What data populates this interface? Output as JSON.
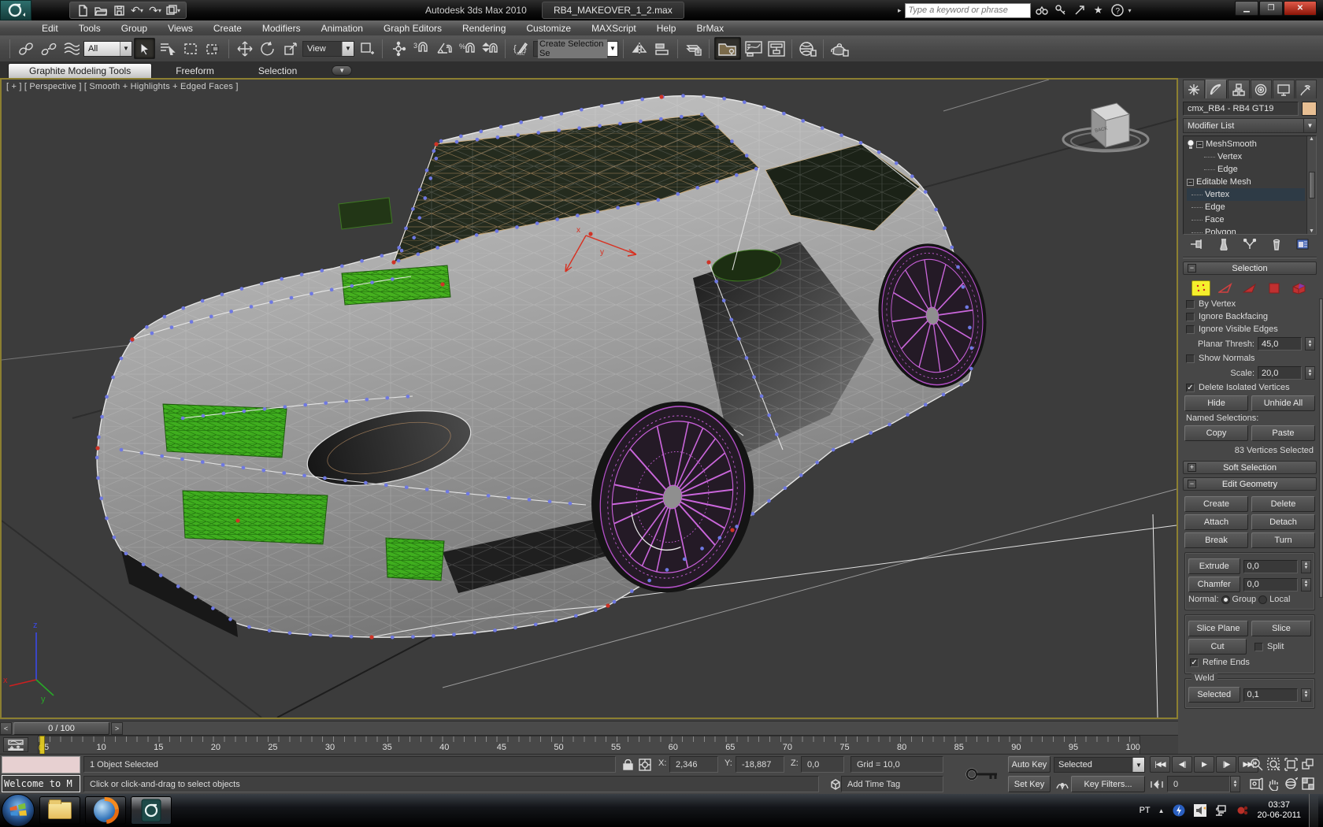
{
  "titlebar": {
    "app_title": "Autodesk 3ds Max 2010",
    "doc_title": "RB4_MAKEOVER_1_2.max",
    "search_placeholder": "Type a keyword or phrase"
  },
  "menubar": {
    "items": [
      "Edit",
      "Tools",
      "Group",
      "Views",
      "Create",
      "Modifiers",
      "Animation",
      "Graph Editors",
      "Rendering",
      "Customize",
      "MAXScript",
      "Help",
      "BrMax"
    ]
  },
  "toolbar": {
    "filter_value": "All",
    "coord_system_value": "View",
    "selection_set_value": "Create Selection Se"
  },
  "ribbon": {
    "tabs": [
      {
        "label": "Graphite Modeling Tools"
      },
      {
        "label": "Freeform"
      },
      {
        "label": "Selection"
      }
    ]
  },
  "viewport": {
    "label": "[ + ] [ Perspective ] [ Smooth + Highlights + Edged Faces ]"
  },
  "command_panel": {
    "object_name": "cmx_RB4 - RB4 GT19",
    "object_color": "#e8bf93",
    "modifier_list_label": "Modifier List",
    "stack": [
      {
        "label": "MeshSmooth"
      },
      {
        "label": "Vertex"
      },
      {
        "label": "Edge"
      },
      {
        "label": "Editable Mesh"
      },
      {
        "label": "Vertex"
      },
      {
        "label": "Edge"
      },
      {
        "label": "Face"
      },
      {
        "label": "Polygon"
      }
    ],
    "selection_rollout": {
      "title": "Selection",
      "by_vertex": "By Vertex",
      "ignore_backfacing": "Ignore Backfacing",
      "ignore_visible_edges": "Ignore Visible Edges",
      "planar_thresh_label": "Planar Thresh:",
      "planar_thresh_value": "45,0",
      "show_normals": "Show Normals",
      "scale_label": "Scale:",
      "scale_value": "20,0",
      "delete_isolated": "Delete Isolated Vertices",
      "hide": "Hide",
      "unhide_all": "Unhide All",
      "named_selections": "Named Selections:",
      "copy": "Copy",
      "paste": "Paste",
      "status": "83 Vertices Selected"
    },
    "soft_selection_title": "Soft Selection",
    "edit_geometry": {
      "title": "Edit Geometry",
      "create": "Create",
      "delete": "Delete",
      "attach": "Attach",
      "detach": "Detach",
      "break": "Break",
      "turn": "Turn",
      "extrude": "Extrude",
      "extrude_value": "0,0",
      "chamfer": "Chamfer",
      "chamfer_value": "0,0",
      "normal_label": "Normal:",
      "group": "Group",
      "local": "Local",
      "slice_plane": "Slice Plane",
      "slice": "Slice",
      "cut": "Cut",
      "split": "Split",
      "refine_ends": "Refine Ends",
      "weld_title": "Weld",
      "weld_selected": "Selected",
      "weld_value": "0,1"
    }
  },
  "timeline": {
    "slider_value": "0 / 100",
    "current_frame": "0",
    "ticks": [
      "5",
      "10",
      "15",
      "20",
      "25",
      "30",
      "35",
      "40",
      "45",
      "50",
      "55",
      "60",
      "65",
      "70",
      "75",
      "80",
      "85",
      "90",
      "95",
      "100"
    ]
  },
  "status_bar": {
    "listener_text": "Welcome to M",
    "selection_status": "1 Object Selected",
    "prompt": "Click or click-and-drag to select objects",
    "x_label": "X:",
    "x_value": "2,346",
    "y_label": "Y:",
    "y_value": "-18,887",
    "z_label": "Z:",
    "z_value": "0,0",
    "grid_value": "Grid = 10,0",
    "auto_key": "Auto Key",
    "set_key": "Set Key",
    "key_mode_value": "Selected",
    "key_filters": "Key Filters...",
    "add_time_tag": "Add Time Tag",
    "frame_field": "0"
  },
  "taskbar": {
    "language": "PT",
    "time": "03:37",
    "date": "20-06-2011"
  }
}
